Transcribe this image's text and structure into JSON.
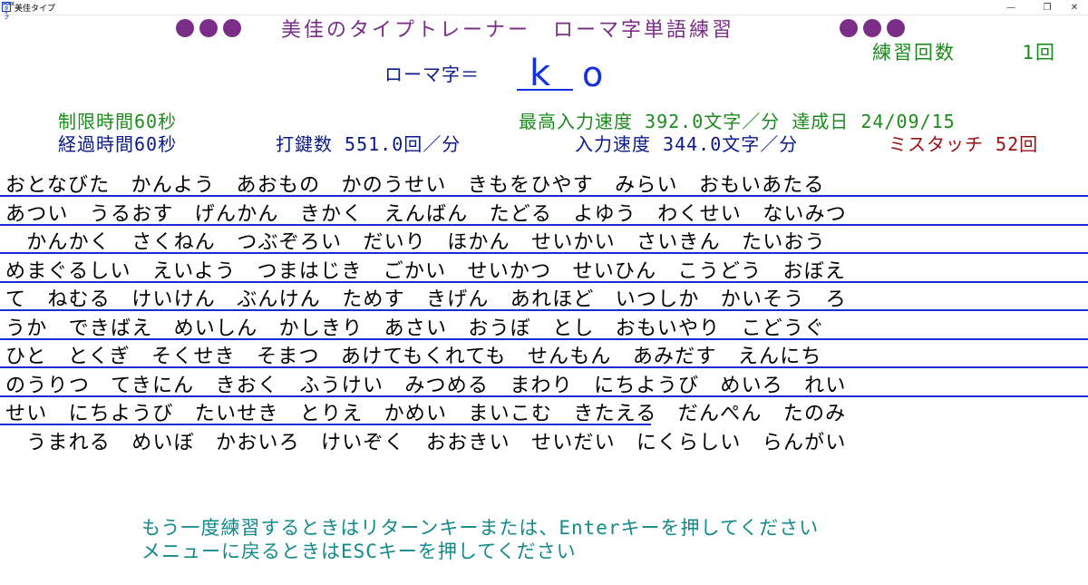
{
  "window": {
    "icon_text": "MAX\nタイプ",
    "title": "美佳タイプ",
    "minimize_glyph": "—",
    "maximize_glyph": "❐",
    "close_glyph": "✕"
  },
  "header": {
    "title": "美佳のタイプトレーナー　ローマ字単語練習",
    "dot_color": "#7b2e87"
  },
  "practice": {
    "label": "練習回数",
    "count": "1回"
  },
  "romaji": {
    "label": "ローマ字＝",
    "current": "k",
    "next": "o"
  },
  "stats": {
    "time_limit": "制限時間60秒",
    "elapsed": "経過時間60秒",
    "keystrokes_label": "打鍵数",
    "keystrokes_value": "551.0回／分",
    "best_speed_label": "最高入力速度",
    "best_speed_value": "392.0文字／分",
    "achieved_label": "達成日",
    "achieved_date": "24/09/15",
    "speed_label": "入力速度",
    "speed_value": "344.0文字／分",
    "mistouch_label": "ミスタッチ",
    "mistouch_value": "52回"
  },
  "typing": {
    "lines": [
      "おとなびた　かんよう　あおもの　かのうせい　きもをひやす　みらい　おもいあたる",
      "あつい　うるおす　げんかん　きかく　えんばん　たどる　よゆう　わくせい　ないみつ",
      "　かんかく　さくねん　つぶぞろい　だいり　ほかん　せいかい　さいきん　たいおう",
      "めまぐるしい　えいよう　つまはじき　ごかい　せいかつ　せいひん　こうどう　おぼえ",
      "て　ねむる　けいけん　ぶんけん　ためす　きげん　あれほど　いつしか　かいそう　ろ",
      "うか　できばえ　めいしん　かしきり　あさい　おうぼ　とし　おもいやり　こどうぐ",
      "ひと　とくぎ　そくせき　そまつ　あけてもくれても　せんもん　あみだす　えんにち",
      "のうりつ　てきにん　きおく　ふうけい　みつめる　まわり　にちようび　めいろ　れい",
      "せい　にちようび　たいせき　とりえ　かめい　まいこむ　きたえる　だんぺん　たのみ",
      "　うまれる　めいぼ　かおいろ　けいぞく　おおきい　せいだい　にくらしい　らんがい"
    ],
    "underline_color": "#1a2bd6"
  },
  "messages": {
    "retry": "もう一度練習するときはリターンキーまたは、Enterキーを押してください",
    "menu": "メニューに戻るときはESCキーを押してください"
  }
}
